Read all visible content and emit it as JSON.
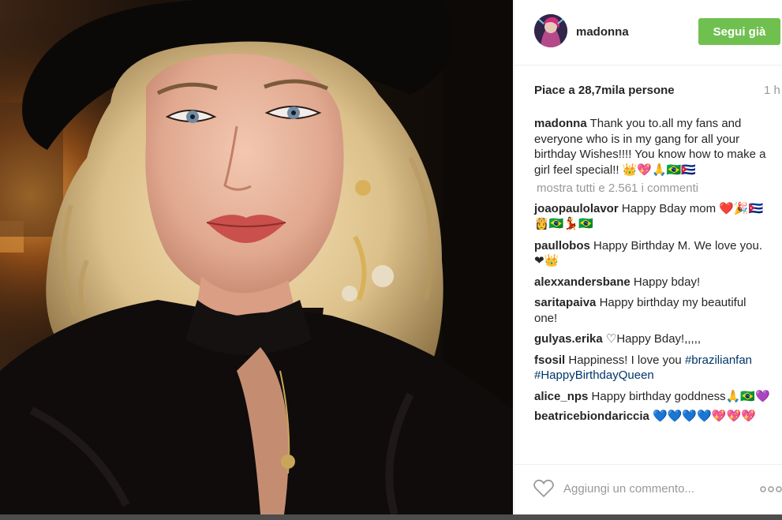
{
  "post": {
    "username": "madonna",
    "follow_label": "Segui già",
    "likes": "Piace a 28,7mila persone",
    "time": "1 h",
    "caption": {
      "user": "madonna",
      "text": "Thank you to.all my fans and everyone who is in my gang for all your birthday Wishes!!!! You know how to make a girl feel special!! 👑💖🙏🇧🇷🇨🇺"
    },
    "load_more": "mostra tutti e 2.561 i commenti",
    "comments": [
      {
        "user": "joaopaulolavor",
        "text": "Happy Bday mom ❤️🎉🇨🇺👸🇧🇷💃🇧🇷"
      },
      {
        "user": "paullobos",
        "text": "Happy Birthday M. We love you. ❤👑"
      },
      {
        "user": "alexxandersbane",
        "text": "Happy bday!"
      },
      {
        "user": "saritapaiva",
        "text": "Happy birthday my beautiful one!"
      },
      {
        "user": "gulyas.erika",
        "text": "♡Happy Bday!,,,,,"
      },
      {
        "user": "fsosil",
        "text": "Happiness! I love you",
        "hashtags": "#brazilianfan #HappyBirthdayQueen"
      },
      {
        "user": "alice_nps",
        "text": "Happy birthday goddness🙏🇧🇷💜"
      },
      {
        "user": "beatricebiondariccia",
        "text": "💙💙💙💙💖💖💖"
      }
    ],
    "comment_placeholder": "Aggiungi un commento...",
    "icons": {
      "like": "heart-outline-icon",
      "more": "more-dots-icon"
    }
  },
  "colors": {
    "follow_button": "#70c050",
    "hashtag": "#003569",
    "muted": "#999999",
    "border": "#efefef"
  }
}
